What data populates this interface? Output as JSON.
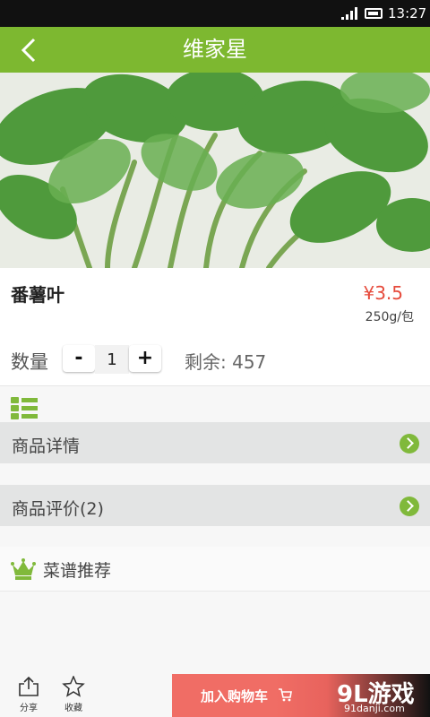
{
  "status_bar": {
    "time": "13:27"
  },
  "header": {
    "title": "维家星"
  },
  "product": {
    "name": "番薯叶",
    "price": "¥3.5",
    "unit": "250g/包",
    "quantity_label": "数量",
    "quantity": "1",
    "minus_label": "-",
    "plus_label": "+",
    "stock": "剩余: 457"
  },
  "sections": {
    "details_label": "商品详情",
    "reviews_label": "商品评价(2)",
    "recipe_label": "菜谱推荐"
  },
  "bottom_bar": {
    "share_label": "分享",
    "favorite_label": "收藏",
    "add_to_cart_label": "加入购物车"
  },
  "watermark": {
    "logo": "9L游戏",
    "url": "91danji.com"
  },
  "colors": {
    "brand_green": "#7db830",
    "price_red": "#e64a3b",
    "cart_button": "#f06d65"
  }
}
